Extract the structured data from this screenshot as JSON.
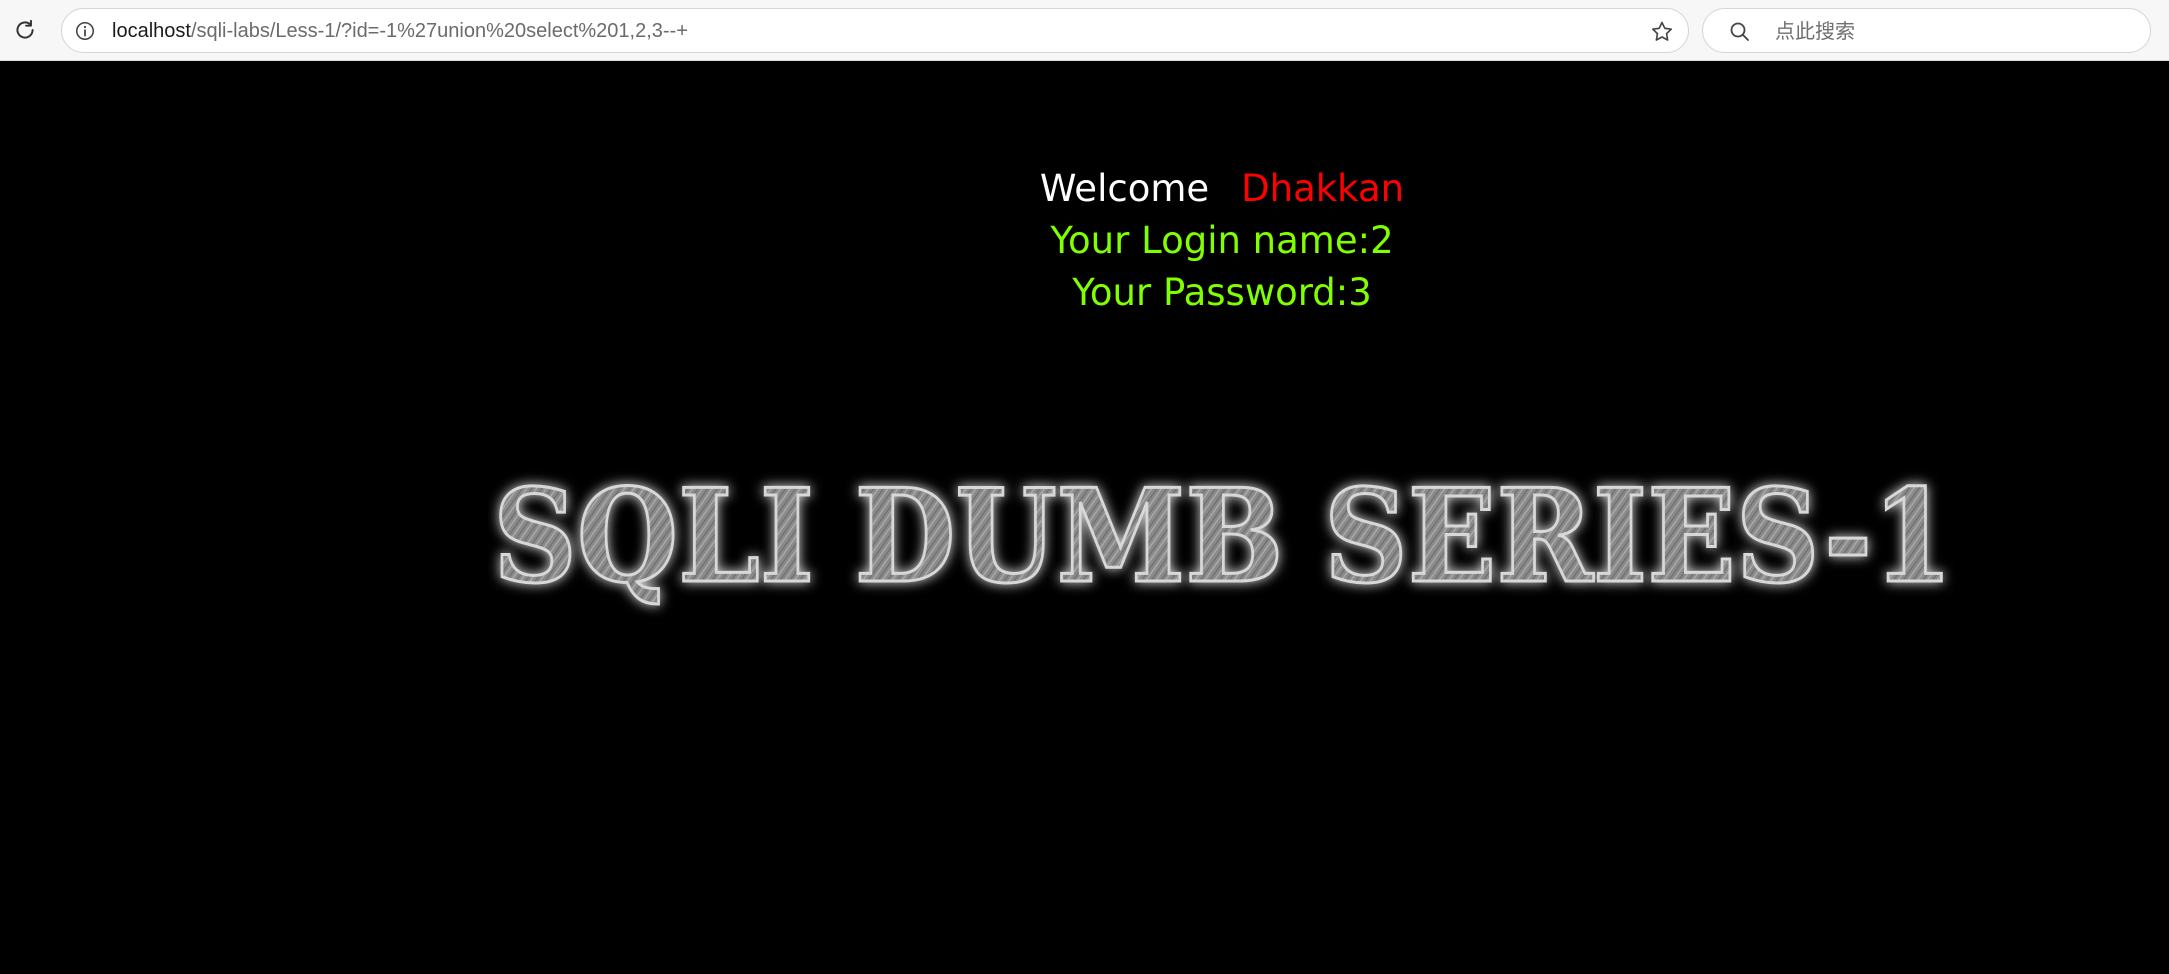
{
  "browser": {
    "address": {
      "host": "localhost",
      "path": "/sqli-labs/Less-1/?id=-1%27union%20select%201,2,3--+"
    },
    "search": {
      "placeholder": "点此搜索"
    },
    "icons": {
      "reload": "reload-icon",
      "info": "info-icon",
      "bookmark": "star-icon",
      "search": "search-icon"
    }
  },
  "page": {
    "welcome_label": "Welcome",
    "welcome_name": "Dhakkan",
    "login_line": "Your Login name:2",
    "password_line": "Your Password:3",
    "logo_text": "SQLI DUMB SERIES-1",
    "colors": {
      "background": "#000000",
      "welcome": "#ffffff",
      "name": "#ff0000",
      "result": "#80ff00"
    }
  }
}
